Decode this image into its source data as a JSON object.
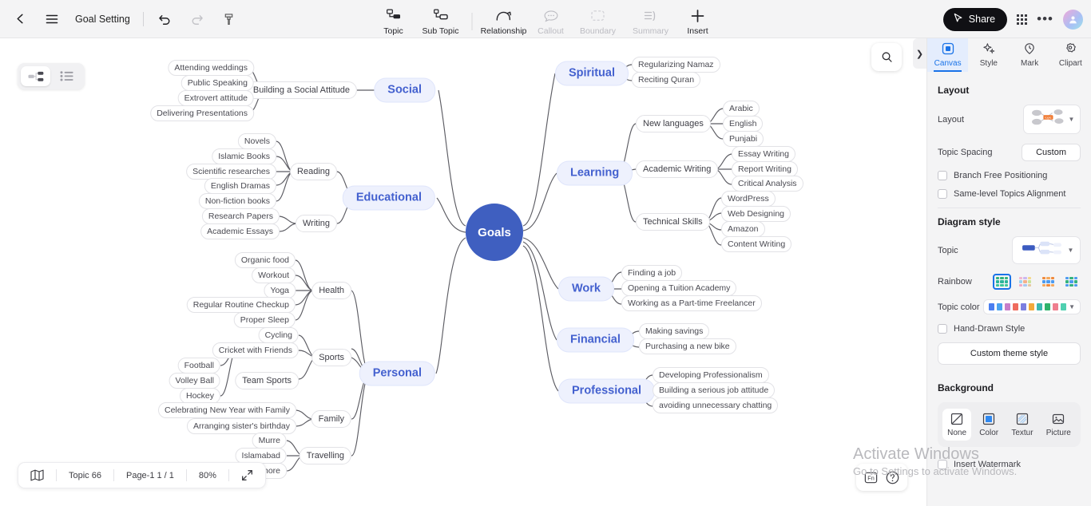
{
  "topbar": {
    "back_icon": "back-arrow-icon",
    "menu_icon": "hamburger-menu-icon",
    "title": "Goal Setting",
    "undo_icon": "undo-icon",
    "redo_icon": "redo-icon",
    "format_painter_icon": "format-painter-icon",
    "tools": [
      {
        "label": "Topic",
        "icon": "topic-icon",
        "disabled": false
      },
      {
        "label": "Sub Topic",
        "icon": "sub-topic-icon",
        "disabled": false
      },
      {
        "label": "Relationship",
        "icon": "relationship-icon",
        "disabled": false
      },
      {
        "label": "Callout",
        "icon": "callout-icon",
        "disabled": true
      },
      {
        "label": "Boundary",
        "icon": "boundary-icon",
        "disabled": true
      },
      {
        "label": "Summary",
        "icon": "summary-icon",
        "disabled": true
      },
      {
        "label": "Insert",
        "icon": "plus-icon",
        "disabled": false
      }
    ],
    "share_label": "Share",
    "share_icon": "cursor-icon",
    "apps_icon": "app-grid-icon",
    "more_icon": "more-options-icon",
    "avatar_icon": "user-avatar-icon"
  },
  "canvas": {
    "view_mindmap_icon": "mindmap-view-icon",
    "view_outline_icon": "outline-view-icon",
    "search_icon": "search-icon",
    "collapse_icon": "chevron-right-icon",
    "root": "Goals",
    "root_color": "#3f5fc0",
    "topic_color": "#4461cf",
    "branches": [
      {
        "name": "Social",
        "side": "left",
        "children": [
          {
            "name": "Building a Social Attitude",
            "leaves": [
              "Attending weddings",
              "Public Speaking",
              "Extrovert attitude",
              "Delivering Presentations"
            ]
          }
        ]
      },
      {
        "name": "Educational",
        "side": "left",
        "children": [
          {
            "name": "Reading",
            "leaves": [
              "Novels",
              "Islamic Books",
              "Scientific researches",
              "English Dramas",
              "Non-fiction books"
            ]
          },
          {
            "name": "Writing",
            "leaves": [
              "Research Papers",
              "Academic Essays"
            ]
          }
        ]
      },
      {
        "name": "Personal",
        "side": "left",
        "children": [
          {
            "name": "Health",
            "leaves": [
              "Organic food",
              "Workout",
              "Yoga",
              "Regular Routine Checkup",
              "Proper Sleep"
            ]
          },
          {
            "name": "Sports",
            "leaves": [
              "Cycling",
              "Cricket with Friends"
            ]
          },
          {
            "name": "Team Sports",
            "leaves": [
              "Football",
              "Volley Ball",
              "Hockey"
            ]
          },
          {
            "name": "Family",
            "leaves": [
              "Celebrating New Year with Family",
              "Arranging sister's birthday"
            ]
          },
          {
            "name": "Travelling",
            "leaves": [
              "Murre",
              "Islamabad",
              "Lahore"
            ]
          }
        ]
      },
      {
        "name": "Spiritual",
        "side": "right",
        "children": [
          {
            "name": null,
            "leaves": [
              "Regularizing Namaz",
              "Reciting Quran"
            ]
          }
        ]
      },
      {
        "name": "Learning",
        "side": "right",
        "children": [
          {
            "name": "New languages",
            "leaves": [
              "Arabic",
              "English",
              "Punjabi"
            ]
          },
          {
            "name": "Academic Writing",
            "leaves": [
              "Essay Writing",
              "Report Writing",
              "Critical Analysis"
            ]
          },
          {
            "name": "Technical Skills",
            "leaves": [
              "WordPress",
              "Web Designing",
              "Amazon",
              "Content Writing"
            ]
          }
        ]
      },
      {
        "name": "Work",
        "side": "right",
        "children": [
          {
            "name": null,
            "leaves": [
              "Finding a job",
              "Opening a Tuition Academy",
              "Working as a Part-time Freelancer"
            ]
          }
        ]
      },
      {
        "name": "Financial",
        "side": "right",
        "children": [
          {
            "name": null,
            "leaves": [
              "Making savings",
              "Purchasing a new bike"
            ]
          }
        ]
      },
      {
        "name": "Professional",
        "side": "right",
        "children": [
          {
            "name": null,
            "leaves": [
              "Developing Professionalism",
              "Building a serious job attitude",
              "avoiding unnecessary chatting"
            ]
          }
        ]
      }
    ]
  },
  "statusbar": {
    "map_icon": "map-overview-icon",
    "topic_count": "Topic 66",
    "page": "Page-1  1 / 1",
    "zoom": "80%",
    "fullscreen_icon": "fullscreen-icon"
  },
  "panel": {
    "tabs": [
      {
        "label": "Canvas",
        "icon": "canvas-icon",
        "active": true
      },
      {
        "label": "Style",
        "icon": "sparkle-icon",
        "active": false
      },
      {
        "label": "Mark",
        "icon": "mark-pin-icon",
        "active": false
      },
      {
        "label": "Clipart",
        "icon": "clipart-icon",
        "active": false
      }
    ],
    "layout": {
      "section_title": "Layout",
      "layout_label": "Layout",
      "layout_preview_icon": "layout-preview-icon",
      "topic_spacing_label": "Topic Spacing",
      "topic_spacing_value": "Custom",
      "branch_free_label": "Branch Free Positioning",
      "branch_free_checked": false,
      "same_level_label": "Same-level Topics Alignment",
      "same_level_checked": false
    },
    "diagram": {
      "section_title": "Diagram style",
      "topic_label": "Topic",
      "topic_preview_icon": "topic-style-preview-icon",
      "rainbow_label": "Rainbow",
      "rainbow_selected_index": 0,
      "rainbow_swatches": [
        [
          "#34b37e",
          "#34b37e",
          "#34b37e",
          "#2bb59a",
          "#2bb59a",
          "#2bb59a",
          "#3ec79a",
          "#3ec79a",
          "#3ec79a"
        ],
        [
          "#f2b6d0",
          "#cbb8f0",
          "#f5d98a",
          "#9fd3f2",
          "#f5b08a",
          "#cbe39a",
          "#f2a8c4",
          "#a8c8f0",
          "#e5c8a0"
        ],
        [
          "#f08a3c",
          "#f5a85c",
          "#f08a3c",
          "#4d9bf0",
          "#4d9bf0",
          "#4d9bf0",
          "#f5a85c",
          "#f08a3c",
          "#f5a85c"
        ],
        [
          "#4d9bf0",
          "#34b37e",
          "#4d9bf0",
          "#34b37e",
          "#4d9bf0",
          "#34b37e",
          "#4d9bf0",
          "#34b37e",
          "#4d9bf0"
        ]
      ],
      "topic_color_label": "Topic color",
      "topic_color_swatches": [
        "#4a7ef0",
        "#4aa3f0",
        "#c77ec9",
        "#ef6b5e",
        "#7b7ee0",
        "#f2a93b",
        "#3bb8b0",
        "#2fb36b",
        "#ef7f8e",
        "#4fd0b0"
      ],
      "hand_drawn_label": "Hand-Drawn Style",
      "hand_drawn_checked": false,
      "custom_theme_label": "Custom theme style"
    },
    "background": {
      "section_title": "Background",
      "options": [
        {
          "label": "None",
          "icon": "none-icon",
          "active": true
        },
        {
          "label": "Color",
          "icon": "color-swatch-icon",
          "active": false
        },
        {
          "label": "Textur",
          "icon": "texture-icon",
          "active": false
        },
        {
          "label": "Picture",
          "icon": "picture-icon",
          "active": false
        }
      ],
      "watermark_label": "Insert Watermark",
      "watermark_checked": false
    }
  },
  "fabs": {
    "fn_icon": "fn-shortcut-icon",
    "help_icon": "help-icon"
  },
  "os_watermark": {
    "line1": "Activate Windows",
    "line2": "Go to Settings to activate Windows."
  }
}
